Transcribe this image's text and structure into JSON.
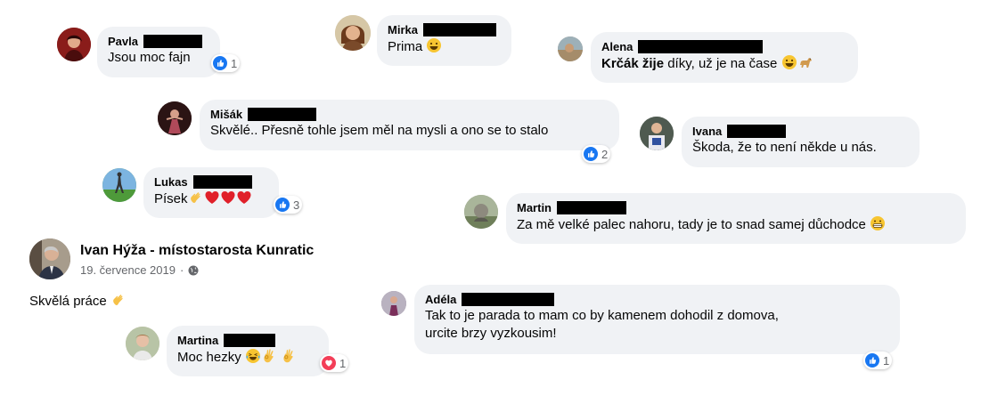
{
  "post": {
    "author": "Ivan Hýža - místostarosta Kunratic",
    "date": "19. července 2019",
    "privacy_icon": "globe-icon",
    "text": "Skvělá práce",
    "text_emoji": "clapping-hands"
  },
  "comments": [
    {
      "id": "pavla",
      "name": "Pavla",
      "text": "Jsou moc fajn",
      "reaction_icon": "like",
      "reaction_count": "1"
    },
    {
      "id": "mirka",
      "name": "Mirka",
      "text": "Prima",
      "emoji": "grinning-face"
    },
    {
      "id": "alena",
      "name": "Alena",
      "mention": "Krčák žije",
      "text": " díky, už je na čase",
      "emoji": "grinning-face, dog"
    },
    {
      "id": "misak",
      "name": "Mišák",
      "text": "Skvělé.. Přesně tohle jsem měl na mysli a ono se to stalo",
      "reaction_icon": "like",
      "reaction_count": "2"
    },
    {
      "id": "ivana",
      "name": "Ivana",
      "text": "Škoda, že to není někde u nás."
    },
    {
      "id": "lukas",
      "name": "Lukas",
      "text": "Písek",
      "emoji": "clapping-hands, red-heart ×3",
      "reaction_icon": "like",
      "reaction_count": "3"
    },
    {
      "id": "martin",
      "name": "Martin",
      "text": "Za mě velké palec nahoru, tady je to snad samej důchodce",
      "emoji": "grimacing-face"
    },
    {
      "id": "adela",
      "name": "Adéla",
      "text_line1": "Tak to je parada to mam co by kamenem dohodil z domova,",
      "text_line2": "urcite brzy vyzkousim!",
      "reaction_icon": "like",
      "reaction_count": "1"
    },
    {
      "id": "martina",
      "name": "Martina",
      "text": "Moc hezky",
      "emoji": "crying-laughing, ok-hand ×2",
      "reaction_icon": "love",
      "reaction_count": "1"
    }
  ],
  "colors": {
    "like": "#1877f2",
    "love": "#f33e58",
    "bubble": "#f0f2f5",
    "secondary_text": "#65676b"
  }
}
